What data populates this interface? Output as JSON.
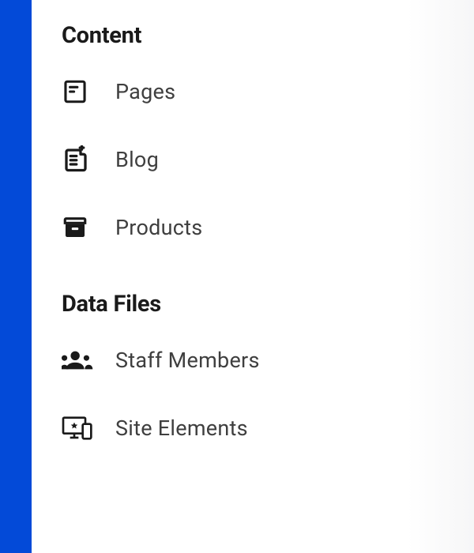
{
  "sidebar": {
    "sections": [
      {
        "heading": "Content",
        "items": [
          {
            "icon": "page-icon",
            "label": "Pages"
          },
          {
            "icon": "blog-icon",
            "label": "Blog"
          },
          {
            "icon": "products-icon",
            "label": "Products"
          }
        ]
      },
      {
        "heading": "Data Files",
        "items": [
          {
            "icon": "staff-icon",
            "label": "Staff Members"
          },
          {
            "icon": "devices-icon",
            "label": "Site Elements"
          }
        ]
      }
    ]
  }
}
